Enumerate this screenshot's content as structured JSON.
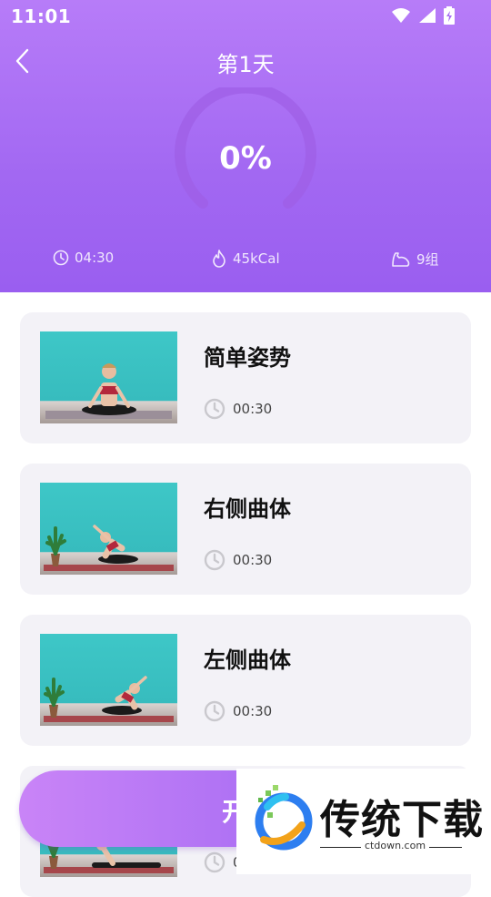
{
  "status_bar": {
    "time": "11:01"
  },
  "header": {
    "title": "第1天",
    "progress_text": "0%",
    "progress_value": 0,
    "stats": {
      "duration": "04:30",
      "calories": "45kCal",
      "groups": "9组"
    }
  },
  "exercises": [
    {
      "name": "简单姿势",
      "duration": "00:30"
    },
    {
      "name": "右侧曲体",
      "duration": "00:30"
    },
    {
      "name": "左侧曲体",
      "duration": "00:30"
    },
    {
      "name": "",
      "duration": "0"
    }
  ],
  "start_button": {
    "label": "开"
  },
  "watermark": {
    "brand": "传统下载",
    "url": "ctdown.com"
  },
  "colors": {
    "header_start": "#b77cf8",
    "header_end": "#9a5ef0",
    "card_bg": "#f3f2f7"
  }
}
